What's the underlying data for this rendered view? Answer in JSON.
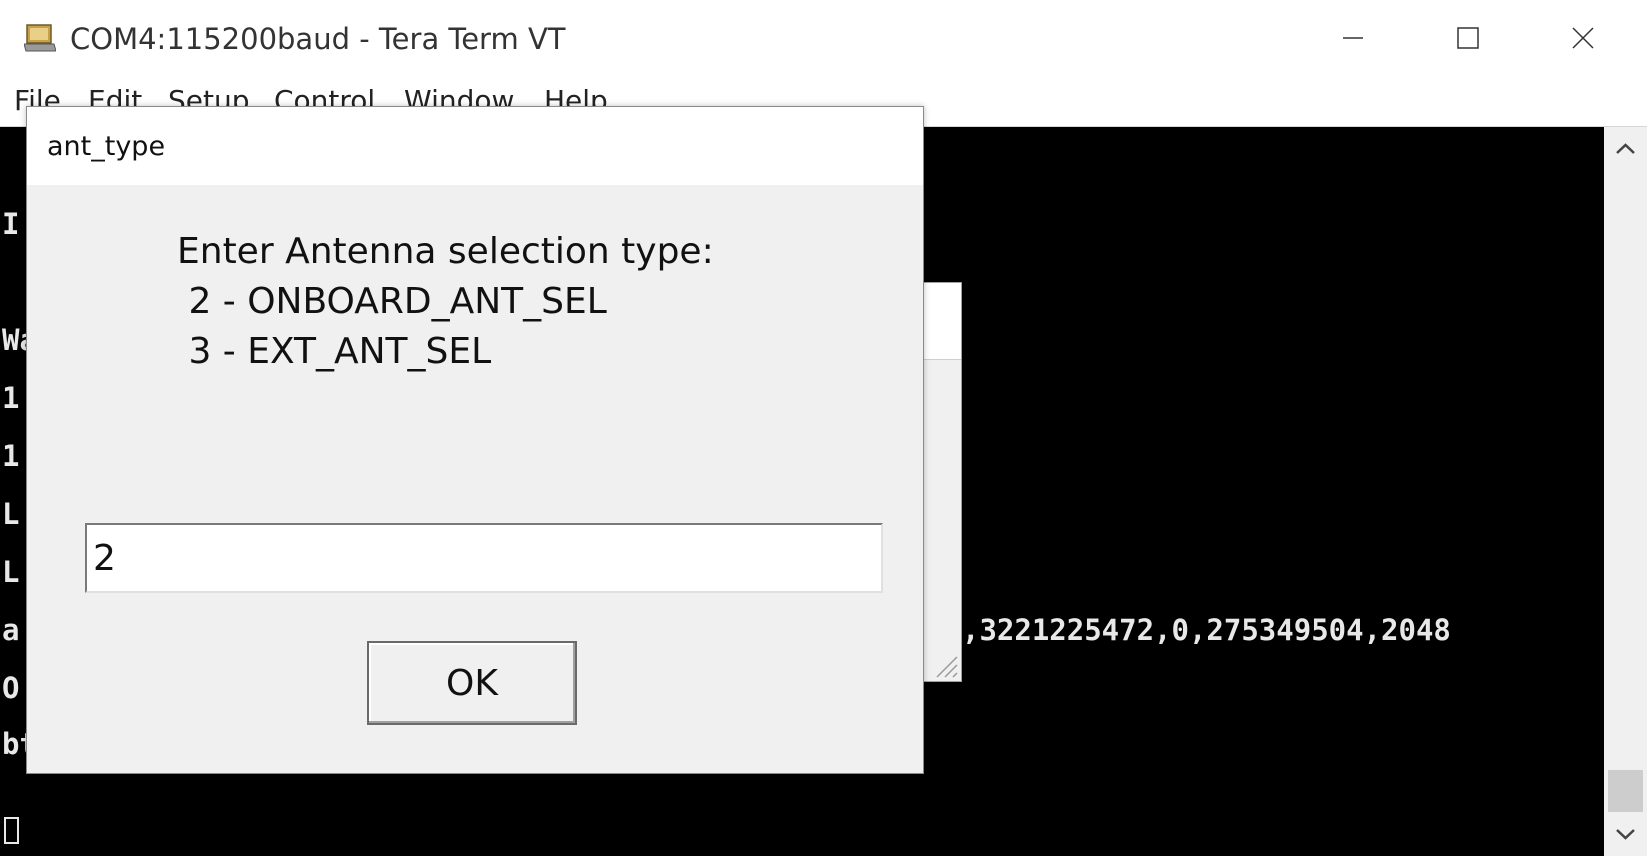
{
  "window": {
    "title": "COM4:115200baud - Tera Term VT",
    "icon": "tera-term-app-icon",
    "controls": [
      "minimize-icon",
      "maximize-icon",
      "close-icon"
    ]
  },
  "menu": {
    "file": "File",
    "edit": "Edit",
    "setup": "Setup",
    "control": "Control",
    "window": "Window",
    "help": "Help"
  },
  "terminal": {
    "lines": [
      "I",
      "Wa",
      "1",
      "1",
      "L",
      "L",
      "a",
      "O",
      "bt_loaded"
    ],
    "at_suffix": ",3221225472,0,275349504,2048"
  },
  "dialog": {
    "title": "ant_type",
    "prompt": {
      "line1": "Enter Antenna selection type:",
      "line2": " 2 - ONBOARD_ANT_SEL",
      "line3": " 3 - EXT_ANT_SEL"
    },
    "input_value": "2",
    "ok_label": "OK"
  },
  "colors": {
    "terminal_bg": "#000000",
    "terminal_fg": "#e8e8e8",
    "dialog_bg": "#f0f0f0"
  }
}
